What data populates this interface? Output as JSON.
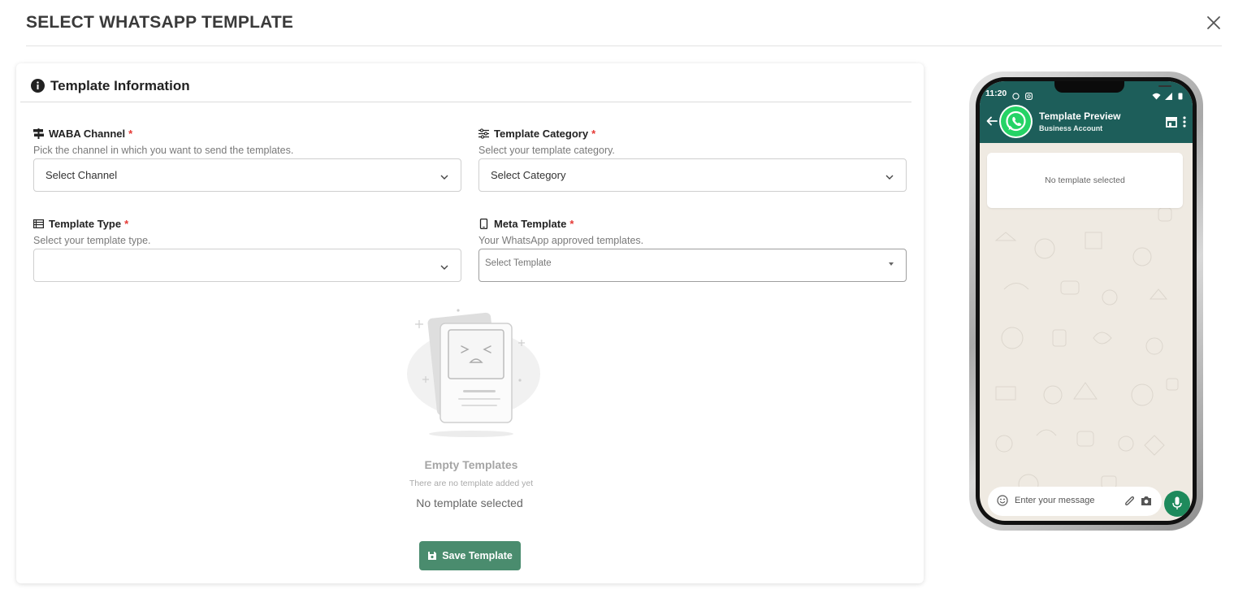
{
  "modal": {
    "title": "SELECT WHATSAPP TEMPLATE",
    "close_icon": "close-icon"
  },
  "card": {
    "title": "Template Information",
    "title_icon": "info-icon"
  },
  "fields": {
    "waba_channel": {
      "label": "WABA Channel",
      "required_mark": "*",
      "help": "Pick the channel in which you want to send the templates.",
      "selected": "Select Channel",
      "icon": "signpost-icon"
    },
    "template_category": {
      "label": "Template Category",
      "required_mark": "*",
      "help": "Select your template category.",
      "selected": "Select Category",
      "icon": "sliders-icon"
    },
    "template_type": {
      "label": "Template Type",
      "required_mark": "*",
      "help": "Select your template type.",
      "selected": "",
      "icon": "list-icon"
    },
    "meta_template": {
      "label": "Meta Template",
      "required_mark": "*",
      "help": "Your WhatsApp approved templates.",
      "selected": "Select Template",
      "icon": "mobile-icon"
    }
  },
  "empty_state": {
    "title": "Empty Templates",
    "subtitle": "There are no template added yet",
    "status": "No template selected"
  },
  "save_button": {
    "label": "Save Template",
    "icon": "floppy-disk-icon"
  },
  "phone_preview": {
    "status_time": "11:20",
    "contact_name": "Template Preview",
    "contact_subtitle": "Business Account",
    "message_placeholder_text": "No template selected",
    "input_placeholder": "Enter your message",
    "colors": {
      "header": "#1d5e5a",
      "mic_button": "#1e8a5c",
      "chat_background": "#efeae2"
    }
  },
  "colors": {
    "accent_green": "#4a8c6e",
    "required": "#e53935"
  }
}
